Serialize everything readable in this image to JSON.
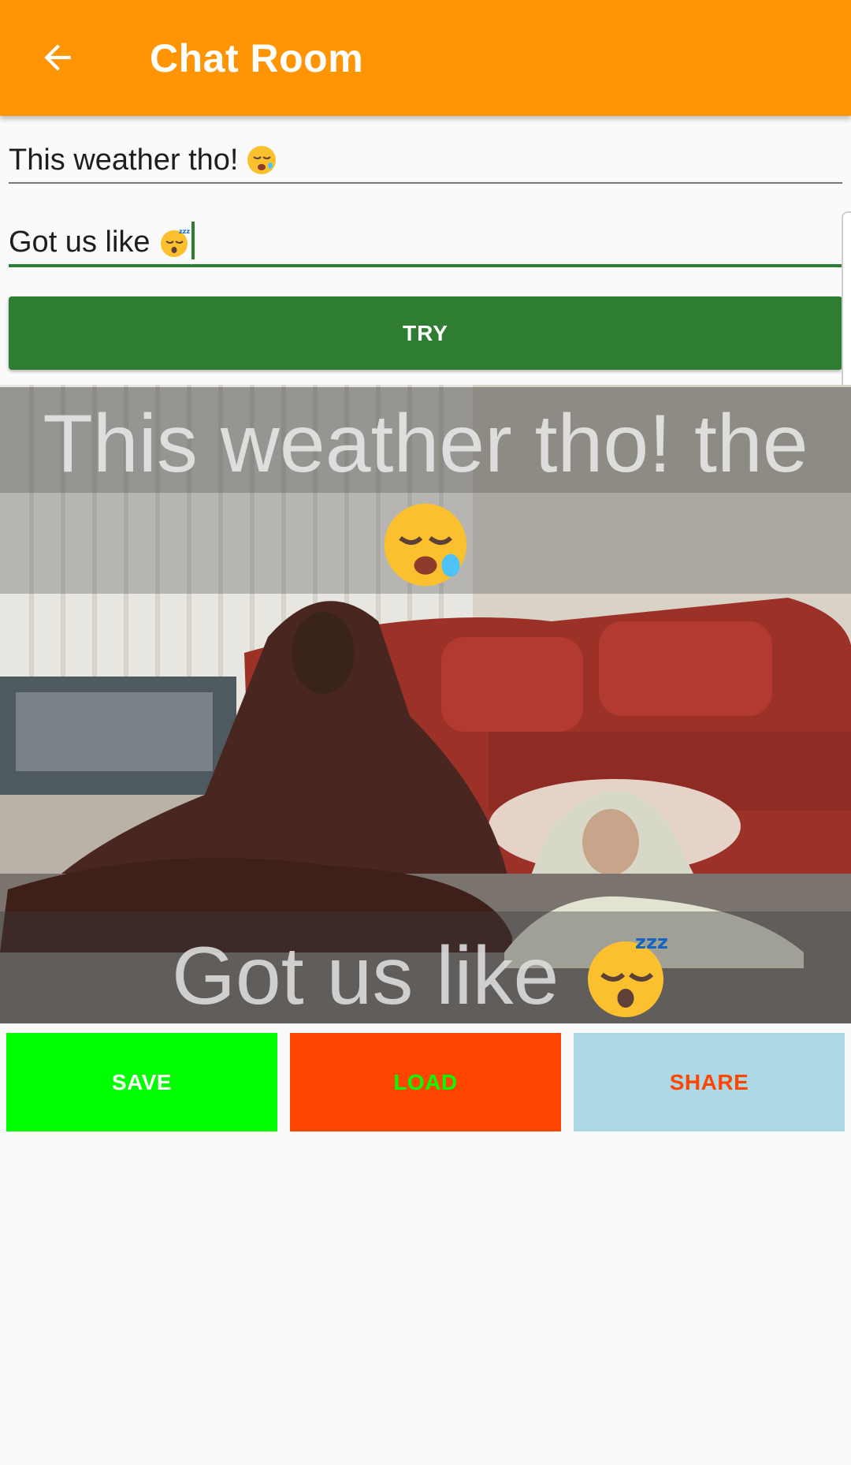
{
  "app_bar": {
    "title": "Chat Room",
    "back_icon": "arrow-back-icon",
    "color": "#ff9405"
  },
  "form": {
    "top_text_value": "This weather tho!",
    "top_text_emoji": "disappointed-relieved-face-emoji",
    "bottom_text_value": "Got us like",
    "bottom_text_emoji": "sleeping-face-emoji",
    "try_label": "TRY",
    "accent": "#2e7d32"
  },
  "meme": {
    "top_caption": "This weather tho! the",
    "bottom_caption": "Got us like"
  },
  "actions": {
    "save_label": "SAVE",
    "load_label": "LOAD",
    "share_label": "SHARE"
  }
}
